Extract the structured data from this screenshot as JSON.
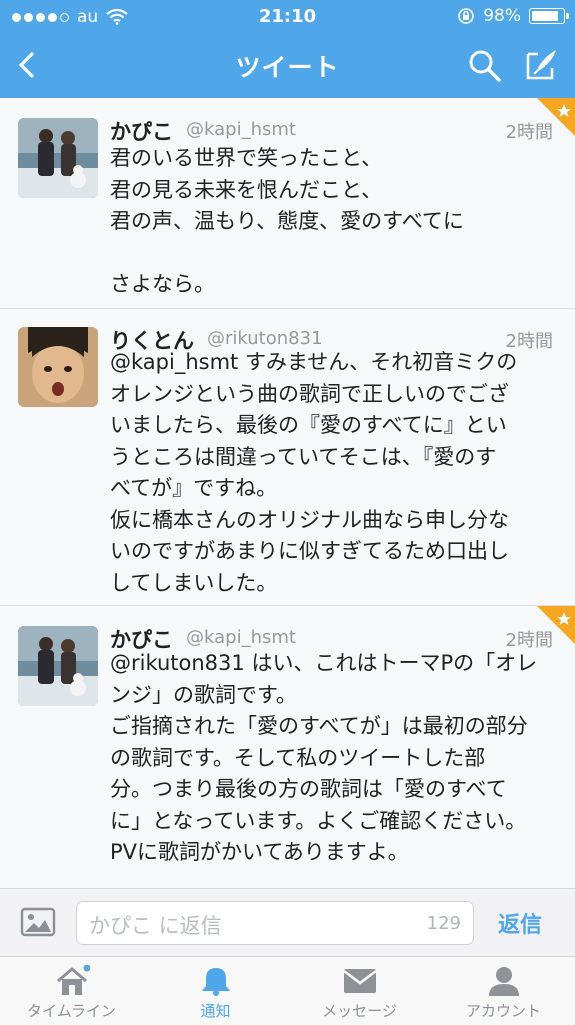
{
  "status_bar": {
    "carrier": "au",
    "time": "21:10",
    "battery": "98%"
  },
  "nav": {
    "title": "ツイート"
  },
  "tweets": [
    {
      "name": "かぴこ",
      "handle": "@kapi_hsmt",
      "time_ago": "2時間",
      "text": "君のいる世界で笑ったこと、\n君の見る未来を恨んだこと、\n君の声、温もり、態度、愛のすべてに\n\nさよなら。",
      "favorited": true
    },
    {
      "name": "りくとん",
      "handle": "@rikuton831",
      "time_ago": "2時間",
      "text": "@kapi_hsmt すみません、それ初音ミクの\nオレンジという曲の歌詞で正しいのでござ\nいましたら、最後の『愛のすべてに』とい\nうところは間違っていてそこは、『愛のす\nべてが』ですね。\n仮に橋本さんのオリジナル曲なら申し分な\nいのですがあまりに似すぎてるため口出し\nしてしまいした。",
      "favorited": false
    },
    {
      "name": "かぴこ",
      "handle": "@kapi_hsmt",
      "time_ago": "2時間",
      "text": "@rikuton831 はい、これはトーマPの「オレ\nンジ」の歌詞です。\nご指摘された「愛のすべてが」は最初の部分\nの歌詞です。そして私のツイートした部\n分。つまり最後の方の歌詞は「愛のすべて\nに」となっています。よくご確認ください。\nPVに歌詞がかいてありますよ。",
      "favorited": true
    }
  ],
  "composer": {
    "placeholder": "かぴこ に返信",
    "char_count": "129",
    "send_label": "返信"
  },
  "tabbar": {
    "tabs": [
      {
        "label": "タイムライン",
        "icon": "home-icon"
      },
      {
        "label": "通知",
        "icon": "bell-icon"
      },
      {
        "label": "メッセージ",
        "icon": "envelope-icon"
      },
      {
        "label": "アカウント",
        "icon": "person-icon"
      }
    ],
    "active_index": 1
  },
  "colors": {
    "accent": "#4fa6e8",
    "favorite": "#f5a623"
  }
}
